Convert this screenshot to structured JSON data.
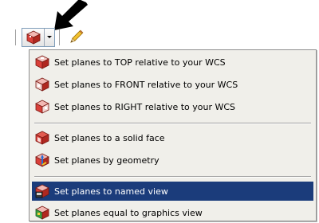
{
  "toolbar": {
    "split_button_icon": "planes-cube-icon",
    "dropdown_icon": "dropdown-triangle-icon",
    "pencil_icon": "pencil-icon"
  },
  "menu": {
    "items": [
      {
        "label": "Set planes to TOP relative to your WCS",
        "icon": "cube-top-icon",
        "selected": false
      },
      {
        "label": "Set planes to FRONT relative to your WCS",
        "icon": "cube-front-icon",
        "selected": false
      },
      {
        "label": "Set planes to RIGHT relative to your WCS",
        "icon": "cube-right-icon",
        "selected": false
      },
      {
        "label": "Set planes to a solid face",
        "icon": "cube-face-icon",
        "selected": false
      },
      {
        "label": "Set planes by geometry",
        "icon": "cube-geometry-icon",
        "selected": false
      },
      {
        "label": "Set planes to named view",
        "icon": "cube-named-view-icon",
        "selected": true
      },
      {
        "label": "Set planes equal to graphics view",
        "icon": "cube-graphics-view-icon",
        "selected": false
      }
    ]
  },
  "colors": {
    "selection": "#1b3c7b",
    "menu_bg": "#f0efea",
    "cube_red": "#d9403a",
    "accent_blue": "#2a6fd6",
    "accent_green": "#3aa040"
  }
}
